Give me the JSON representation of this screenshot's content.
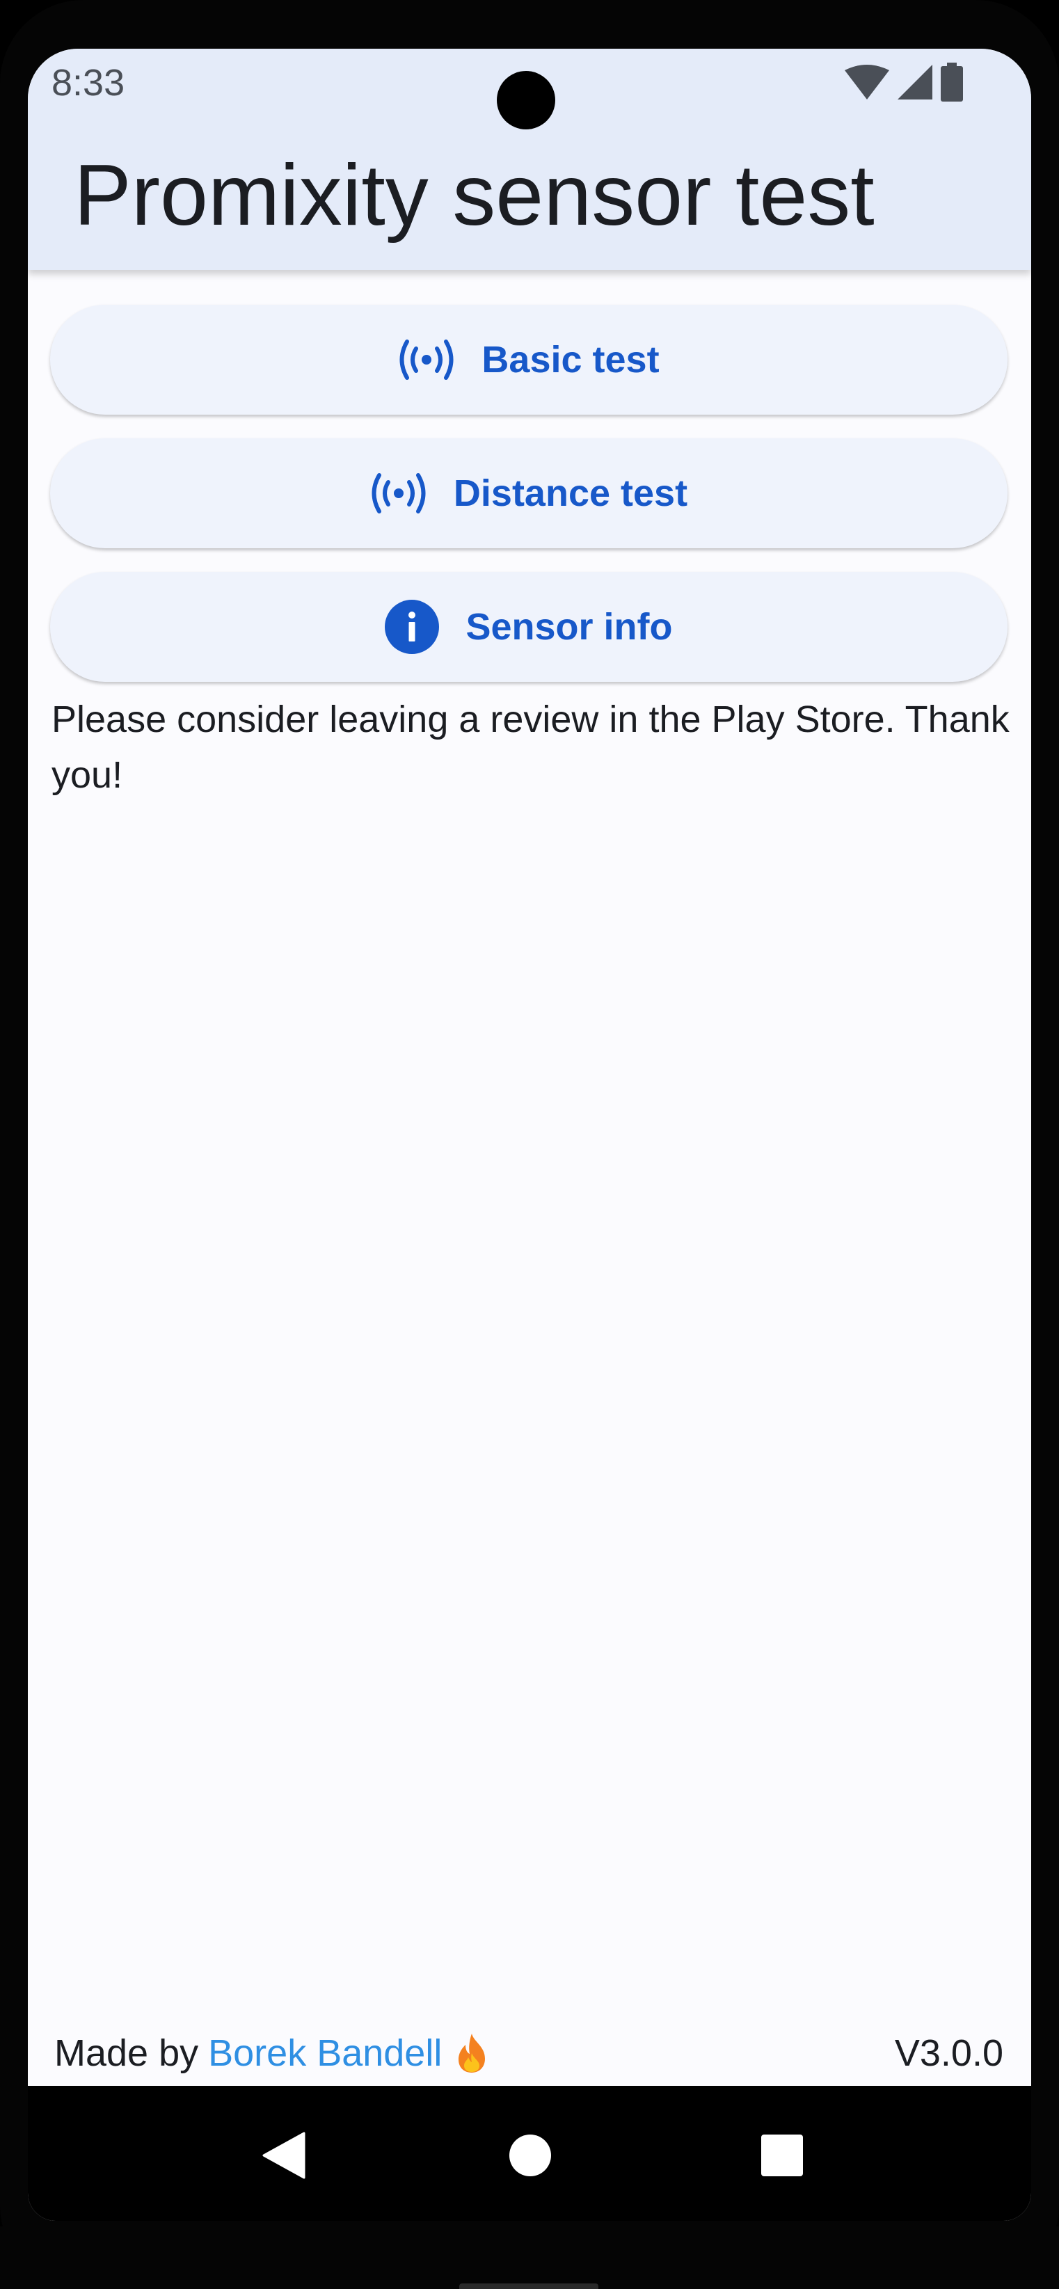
{
  "status_bar": {
    "time": "8:33",
    "icons": [
      "wifi-icon",
      "signal-icon",
      "battery-icon"
    ]
  },
  "app_bar": {
    "title": "Promixity sensor test"
  },
  "buttons": [
    {
      "label": "Basic test",
      "icon": "sensor-waves-icon"
    },
    {
      "label": "Distance test",
      "icon": "sensor-waves-icon"
    },
    {
      "label": "Sensor info",
      "icon": "info-icon"
    }
  ],
  "note": "Please consider leaving a review in the Play Store. Thank you!",
  "footer": {
    "made_by_prefix": "Made by",
    "author": "Borek Bandell",
    "emoji": "fire-icon",
    "version": "V3.0.0"
  },
  "nav_bar": {
    "items": [
      "back-icon",
      "home-icon",
      "recents-icon"
    ]
  },
  "colors": {
    "app_bar_bg": "#e4ebf9",
    "button_bg": "#eff3fc",
    "accent": "#1758c9",
    "link": "#2f8fe3",
    "background": "#fbfbfe"
  }
}
